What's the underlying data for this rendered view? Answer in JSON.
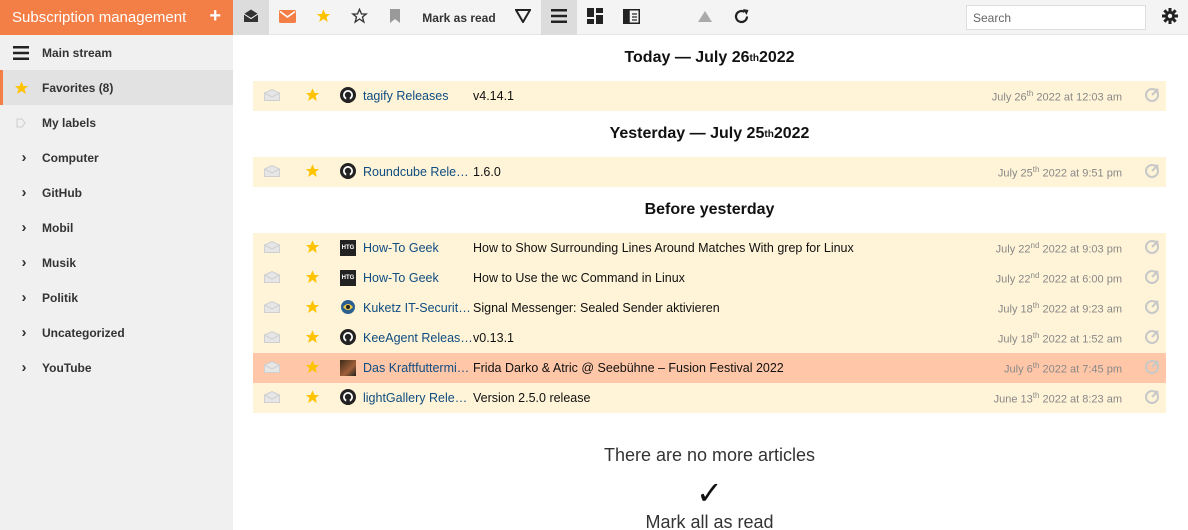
{
  "sidebar": {
    "subscription_label": "Subscription management",
    "plus_label": "+",
    "items": [
      {
        "label": "Main stream",
        "icon": "hamburger-icon"
      },
      {
        "label": "Favorites (8)",
        "icon": "star-icon"
      },
      {
        "label": "My labels",
        "icon": "label-icon"
      },
      {
        "label": "Computer",
        "icon": "chevron-right-icon"
      },
      {
        "label": "GitHub",
        "icon": "chevron-right-icon"
      },
      {
        "label": "Mobil",
        "icon": "chevron-right-icon"
      },
      {
        "label": "Musik",
        "icon": "chevron-right-icon"
      },
      {
        "label": "Politik",
        "icon": "chevron-right-icon"
      },
      {
        "label": "Uncategorized",
        "icon": "chevron-right-icon"
      },
      {
        "label": "YouTube",
        "icon": "chevron-right-icon"
      }
    ],
    "chevron": "›"
  },
  "toolbar": {
    "mark_as_read_label": "Mark as read",
    "search_placeholder": "Search"
  },
  "sections": [
    {
      "heading_pre": "Today — July 26",
      "heading_sup": "th",
      "heading_post": " 2022",
      "articles": [
        {
          "feed": "tagify Releases",
          "favicon": "github-icon",
          "title": "v4.14.1",
          "date_pre": "July 26",
          "date_sup": "th",
          "date_post": " 2022 at 12:03 am"
        }
      ]
    },
    {
      "heading_pre": "Yesterday — July 25",
      "heading_sup": "th",
      "heading_post": " 2022",
      "articles": [
        {
          "feed": "Roundcube Releases",
          "favicon": "github-icon",
          "title": "1.6.0",
          "date_pre": "July 25",
          "date_sup": "th",
          "date_post": " 2022 at 9:51 pm"
        }
      ]
    },
    {
      "heading_pre": "Before yesterday",
      "heading_sup": "",
      "heading_post": "",
      "articles": [
        {
          "feed": "How-To Geek",
          "favicon": "htg-icon",
          "title": "How to Show Surrounding Lines Around Matches With grep for Linux",
          "date_pre": "July 22",
          "date_sup": "nd",
          "date_post": " 2022 at 9:03 pm"
        },
        {
          "feed": "How-To Geek",
          "favicon": "htg-icon",
          "title": "How to Use the wc Command in Linux",
          "date_pre": "July 22",
          "date_sup": "nd",
          "date_post": " 2022 at 6:00 pm"
        },
        {
          "feed": "Kuketz IT-Security Blog",
          "favicon": "kuketz-icon",
          "title": "Signal Messenger: Sealed Sender aktivieren",
          "date_pre": "July 18",
          "date_sup": "th",
          "date_post": " 2022 at 9:23 am"
        },
        {
          "feed": "KeeAgent Releases",
          "favicon": "github-icon",
          "title": "v0.13.1",
          "date_pre": "July 18",
          "date_sup": "th",
          "date_post": " 2022 at 1:52 am"
        },
        {
          "feed": "Das Kraftfuttermischwerk",
          "favicon": "photo-icon",
          "title": "Frida Darko & Atric @ Seebühne – Fusion Festival 2022",
          "date_pre": "July 6",
          "date_sup": "th",
          "date_post": " 2022 at 7:45 pm",
          "selected": true
        },
        {
          "feed": "lightGallery Releases",
          "favicon": "github-icon",
          "title": "Version 2.5.0 release",
          "date_pre": "June 13",
          "date_sup": "th",
          "date_post": " 2022 at 8:23 am"
        }
      ]
    }
  ],
  "footer": {
    "no_more": "There are no more articles",
    "check": "✓",
    "mark_all": "Mark all as read"
  },
  "colors": {
    "accent": "#f47f46",
    "favorite": "#ffc300",
    "row_bg": "#fff4d7",
    "row_selected": "#ffc7a8"
  }
}
